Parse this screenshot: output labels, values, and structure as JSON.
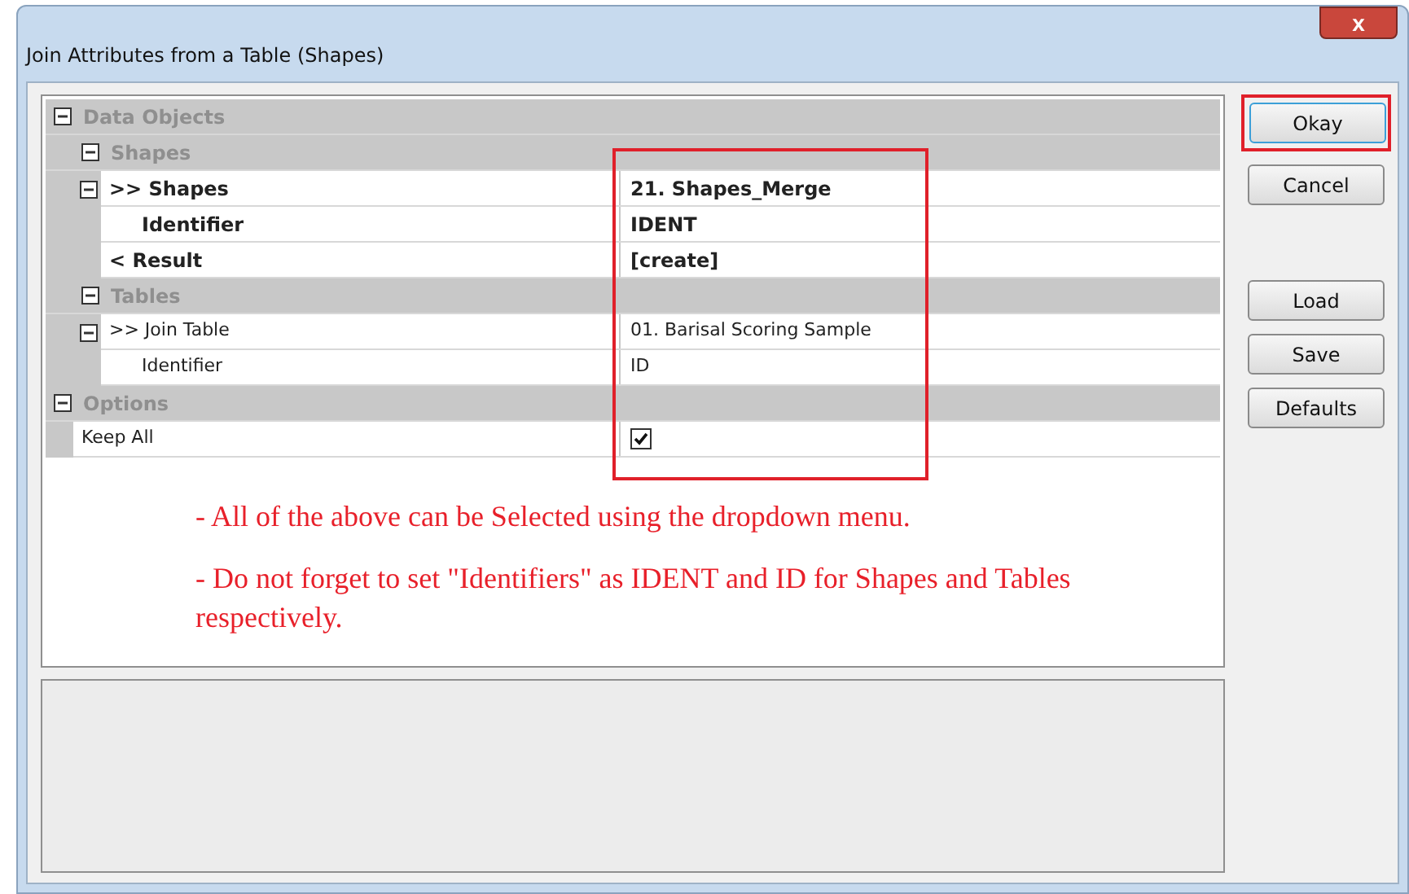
{
  "window": {
    "title": "Join Attributes from a Table (Shapes)",
    "close_label": "x"
  },
  "properties": [
    {
      "kind": "category",
      "name": "Data Objects",
      "expanded": true,
      "children": [
        {
          "kind": "category",
          "name": "Shapes",
          "expanded": true,
          "children": [
            {
              "kind": "value",
              "name": ">> Shapes",
              "value": "21. Shapes_Merge",
              "bold": true,
              "expanded": true,
              "children": [
                {
                  "kind": "value",
                  "name": "Identifier",
                  "value": "IDENT",
                  "bold": true
                }
              ]
            },
            {
              "kind": "value",
              "name": "< Result",
              "value": "[create]",
              "bold": true
            }
          ]
        },
        {
          "kind": "category",
          "name": "Tables",
          "expanded": true,
          "children": [
            {
              "kind": "value",
              "name": ">> Join Table",
              "value": "01. Barisal Scoring Sample",
              "bold": false,
              "expanded": true,
              "children": [
                {
                  "kind": "value",
                  "name": "Identifier",
                  "value": "ID",
                  "bold": false
                }
              ]
            }
          ]
        }
      ]
    },
    {
      "kind": "category",
      "name": "Options",
      "expanded": true,
      "children": [
        {
          "kind": "checkbox",
          "name": "Keep All",
          "checked": true
        }
      ]
    }
  ],
  "notes": [
    "- All of the above can be  Selected using the dropdown menu.",
    "- Do not forget to set \"Identifiers\" as IDENT and ID for Shapes and Tables respectively."
  ],
  "buttons": [
    {
      "label": "Okay",
      "highlighted": true
    },
    {
      "label": "Cancel",
      "highlighted": false
    },
    {
      "label": "Load",
      "highlighted": false
    },
    {
      "label": "Save",
      "highlighted": false
    },
    {
      "label": "Defaults",
      "highlighted": false
    }
  ]
}
